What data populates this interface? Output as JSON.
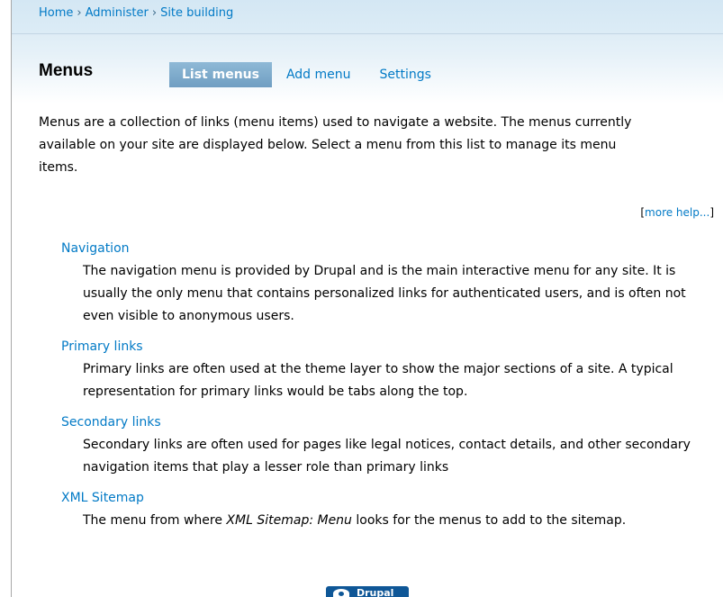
{
  "breadcrumb": {
    "items": [
      "Home",
      "Administer",
      "Site building"
    ],
    "separator": "›"
  },
  "page": {
    "title": "Menus"
  },
  "tabs": [
    {
      "label": "List menus",
      "active": true
    },
    {
      "label": "Add menu",
      "active": false
    },
    {
      "label": "Settings",
      "active": false
    }
  ],
  "intro": {
    "text": "Menus are a collection of links (menu items) used to navigate a website. The menus currently available on your site are displayed below. Select a menu from this list to manage its menu items.",
    "more_help": "more help..."
  },
  "menus": [
    {
      "name": "Navigation",
      "description": "The navigation menu is provided by Drupal and is the main interactive menu for any site. It is usually the only menu that contains personalized links for authenticated users, and is often not even visible to anonymous users."
    },
    {
      "name": "Primary links",
      "description": "Primary links are often used at the theme layer to show the major sections of a site. A typical representation for primary links would be tabs along the top."
    },
    {
      "name": "Secondary links",
      "description": "Secondary links are often used for pages like legal notices, contact details, and other secondary navigation items that play a lesser role than primary links"
    },
    {
      "name": "XML Sitemap",
      "description_parts": [
        "The menu from where ",
        "XML Sitemap: Menu",
        " looks for the menus to add to the sitemap."
      ]
    }
  ],
  "footer": {
    "badge_label": "Drupal",
    "badge_icon": "drupal-drop-icon"
  },
  "colors": {
    "link": "#027ac6",
    "active_tab_bg": "#7fadcf",
    "header_bg": "#d4e7f4",
    "badge_bg": "#0f5797"
  }
}
